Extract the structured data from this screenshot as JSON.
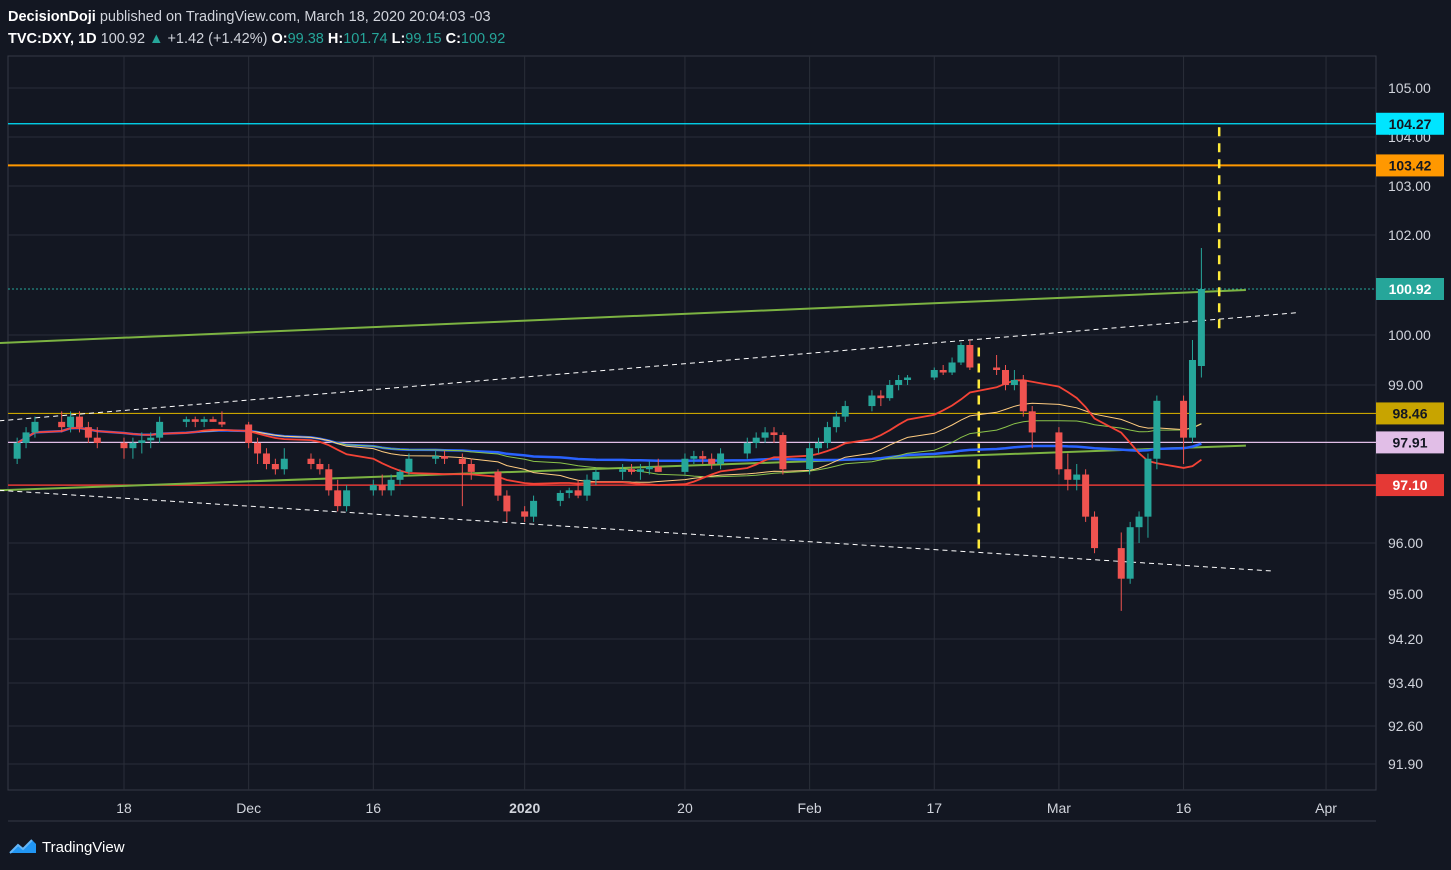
{
  "header": {
    "author": "DecisionDoji",
    "published": "published on TradingView.com, March 18, 2020 20:04:03 -03",
    "symbol": "TVC:DXY, 1D",
    "last": "100.92",
    "change": "+1.42 (+1.42%)",
    "o_label": "O:",
    "o_value": "99.38",
    "h_label": "H:",
    "h_value": "101.74",
    "l_label": "L:",
    "l_value": "99.15",
    "c_label": "C:",
    "c_value": "100.92"
  },
  "footer": {
    "brand": "TradingView"
  },
  "colors": {
    "background": "#131722",
    "grid": "#2a2e39",
    "up": "#26a69a",
    "down": "#ef5350",
    "cyan": "#00e5ff",
    "orange": "#ff9800",
    "gold": "#c8a400",
    "pink": "#e1bee7",
    "red": "#e53935",
    "green": "#7cb342",
    "yellow": "#ffeb3b",
    "blue": "#2962ff"
  },
  "chart_data": {
    "type": "candlestick",
    "x_ticks": [
      {
        "label": "18",
        "date": "2019-11-18",
        "bold": false
      },
      {
        "label": "Dec",
        "date": "2019-12-02",
        "bold": false
      },
      {
        "label": "16",
        "date": "2019-12-16",
        "bold": false
      },
      {
        "label": "2020",
        "date": "2020-01-02",
        "bold": true
      },
      {
        "label": "20",
        "date": "2020-01-20",
        "bold": false
      },
      {
        "label": "Feb",
        "date": "2020-02-03",
        "bold": false
      },
      {
        "label": "17",
        "date": "2020-02-17",
        "bold": false
      },
      {
        "label": "Mar",
        "date": "2020-03-02",
        "bold": false
      },
      {
        "label": "16",
        "date": "2020-03-16",
        "bold": false
      },
      {
        "label": "Apr",
        "date": "2020-04-01",
        "bold": false
      }
    ],
    "y_ticks": [
      "105.00",
      "104.00",
      "103.00",
      "102.00",
      "100.00",
      "99.00",
      "96.00",
      "95.00",
      "94.20",
      "93.40",
      "92.60",
      "91.90"
    ],
    "price_labels": [
      {
        "text": "104.27",
        "value": 104.27,
        "style": "cyan"
      },
      {
        "text": "103.42",
        "value": 103.42,
        "style": "orange"
      },
      {
        "text": "100.92",
        "value": 100.92,
        "style": "last"
      },
      {
        "text": "98.46",
        "value": 98.46,
        "style": "gold"
      },
      {
        "text": "97.91",
        "value": 97.91,
        "style": "pink"
      },
      {
        "text": "97.10",
        "value": 97.1,
        "style": "red"
      }
    ],
    "candles": [
      {
        "d": "2019-11-06",
        "o": 97.6,
        "h": 98.0,
        "l": 97.5,
        "c": 97.9
      },
      {
        "d": "2019-11-07",
        "o": 97.9,
        "h": 98.2,
        "l": 97.8,
        "c": 98.1
      },
      {
        "d": "2019-11-08",
        "o": 98.1,
        "h": 98.4,
        "l": 98.0,
        "c": 98.3
      },
      {
        "d": "2019-11-11",
        "o": 98.3,
        "h": 98.5,
        "l": 98.1,
        "c": 98.2
      },
      {
        "d": "2019-11-12",
        "o": 98.2,
        "h": 98.5,
        "l": 98.1,
        "c": 98.4
      },
      {
        "d": "2019-11-13",
        "o": 98.4,
        "h": 98.5,
        "l": 98.1,
        "c": 98.2
      },
      {
        "d": "2019-11-14",
        "o": 98.2,
        "h": 98.3,
        "l": 97.9,
        "c": 98.0
      },
      {
        "d": "2019-11-15",
        "o": 98.0,
        "h": 98.2,
        "l": 97.8,
        "c": 97.9
      },
      {
        "d": "2019-11-18",
        "o": 97.9,
        "h": 98.0,
        "l": 97.6,
        "c": 97.8
      },
      {
        "d": "2019-11-19",
        "o": 97.8,
        "h": 98.0,
        "l": 97.6,
        "c": 97.9
      },
      {
        "d": "2019-11-20",
        "o": 97.9,
        "h": 98.1,
        "l": 97.7,
        "c": 97.95
      },
      {
        "d": "2019-11-21",
        "o": 97.95,
        "h": 98.1,
        "l": 97.8,
        "c": 98.0
      },
      {
        "d": "2019-11-22",
        "o": 98.0,
        "h": 98.4,
        "l": 97.9,
        "c": 98.3
      },
      {
        "d": "2019-11-25",
        "o": 98.3,
        "h": 98.4,
        "l": 98.2,
        "c": 98.35
      },
      {
        "d": "2019-11-26",
        "o": 98.35,
        "h": 98.4,
        "l": 98.2,
        "c": 98.3
      },
      {
        "d": "2019-11-27",
        "o": 98.3,
        "h": 98.4,
        "l": 98.2,
        "c": 98.35
      },
      {
        "d": "2019-11-28",
        "o": 98.35,
        "h": 98.4,
        "l": 98.3,
        "c": 98.3
      },
      {
        "d": "2019-11-29",
        "o": 98.3,
        "h": 98.5,
        "l": 98.2,
        "c": 98.25
      },
      {
        "d": "2019-12-02",
        "o": 98.25,
        "h": 98.3,
        "l": 97.8,
        "c": 97.9
      },
      {
        "d": "2019-12-03",
        "o": 97.9,
        "h": 98.0,
        "l": 97.5,
        "c": 97.7
      },
      {
        "d": "2019-12-04",
        "o": 97.7,
        "h": 97.8,
        "l": 97.4,
        "c": 97.5
      },
      {
        "d": "2019-12-05",
        "o": 97.5,
        "h": 97.6,
        "l": 97.3,
        "c": 97.4
      },
      {
        "d": "2019-12-06",
        "o": 97.4,
        "h": 97.8,
        "l": 97.3,
        "c": 97.6
      },
      {
        "d": "2019-12-09",
        "o": 97.6,
        "h": 97.7,
        "l": 97.4,
        "c": 97.5
      },
      {
        "d": "2019-12-10",
        "o": 97.5,
        "h": 97.6,
        "l": 97.3,
        "c": 97.4
      },
      {
        "d": "2019-12-11",
        "o": 97.4,
        "h": 97.5,
        "l": 96.9,
        "c": 97.0
      },
      {
        "d": "2019-12-12",
        "o": 97.0,
        "h": 97.2,
        "l": 96.6,
        "c": 96.7
      },
      {
        "d": "2019-12-13",
        "o": 96.7,
        "h": 97.1,
        "l": 96.6,
        "c": 97.0
      },
      {
        "d": "2019-12-16",
        "o": 97.0,
        "h": 97.2,
        "l": 96.9,
        "c": 97.1
      },
      {
        "d": "2019-12-17",
        "o": 97.1,
        "h": 97.3,
        "l": 96.9,
        "c": 97.0
      },
      {
        "d": "2019-12-18",
        "o": 97.0,
        "h": 97.3,
        "l": 96.9,
        "c": 97.2
      },
      {
        "d": "2019-12-19",
        "o": 97.2,
        "h": 97.4,
        "l": 97.1,
        "c": 97.35
      },
      {
        "d": "2019-12-20",
        "o": 97.35,
        "h": 97.7,
        "l": 97.3,
        "c": 97.6
      },
      {
        "d": "2019-12-23",
        "o": 97.6,
        "h": 97.75,
        "l": 97.5,
        "c": 97.65
      },
      {
        "d": "2019-12-24",
        "o": 97.65,
        "h": 97.75,
        "l": 97.5,
        "c": 97.6
      },
      {
        "d": "2019-12-26",
        "o": 97.6,
        "h": 97.7,
        "l": 96.7,
        "c": 97.5
      },
      {
        "d": "2019-12-27",
        "o": 97.5,
        "h": 97.6,
        "l": 97.2,
        "c": 97.35
      },
      {
        "d": "2019-12-30",
        "o": 97.35,
        "h": 97.4,
        "l": 96.8,
        "c": 96.9
      },
      {
        "d": "2019-12-31",
        "o": 96.9,
        "h": 97.0,
        "l": 96.4,
        "c": 96.6
      },
      {
        "d": "2020-01-02",
        "o": 96.6,
        "h": 96.7,
        "l": 96.4,
        "c": 96.5
      },
      {
        "d": "2020-01-03",
        "o": 96.5,
        "h": 96.9,
        "l": 96.4,
        "c": 96.8
      },
      {
        "d": "2020-01-06",
        "o": 96.8,
        "h": 97.0,
        "l": 96.7,
        "c": 96.95
      },
      {
        "d": "2020-01-07",
        "o": 96.95,
        "h": 97.05,
        "l": 96.85,
        "c": 97.0
      },
      {
        "d": "2020-01-08",
        "o": 97.0,
        "h": 97.2,
        "l": 96.85,
        "c": 96.9
      },
      {
        "d": "2020-01-09",
        "o": 96.9,
        "h": 97.3,
        "l": 96.8,
        "c": 97.2
      },
      {
        "d": "2020-01-10",
        "o": 97.2,
        "h": 97.4,
        "l": 97.1,
        "c": 97.35
      },
      {
        "d": "2020-01-13",
        "o": 97.35,
        "h": 97.5,
        "l": 97.2,
        "c": 97.4
      },
      {
        "d": "2020-01-14",
        "o": 97.4,
        "h": 97.5,
        "l": 97.3,
        "c": 97.35
      },
      {
        "d": "2020-01-15",
        "o": 97.35,
        "h": 97.5,
        "l": 97.2,
        "c": 97.4
      },
      {
        "d": "2020-01-16",
        "o": 97.4,
        "h": 97.55,
        "l": 97.3,
        "c": 97.45
      },
      {
        "d": "2020-01-17",
        "o": 97.45,
        "h": 97.6,
        "l": 97.35,
        "c": 97.35
      },
      {
        "d": "2020-01-20",
        "o": 97.35,
        "h": 97.7,
        "l": 97.3,
        "c": 97.6
      },
      {
        "d": "2020-01-21",
        "o": 97.6,
        "h": 97.75,
        "l": 97.5,
        "c": 97.65
      },
      {
        "d": "2020-01-22",
        "o": 97.65,
        "h": 97.75,
        "l": 97.5,
        "c": 97.6
      },
      {
        "d": "2020-01-23",
        "o": 97.6,
        "h": 97.7,
        "l": 97.4,
        "c": 97.5
      },
      {
        "d": "2020-01-24",
        "o": 97.5,
        "h": 97.8,
        "l": 97.4,
        "c": 97.7
      },
      {
        "d": "2020-01-27",
        "o": 97.7,
        "h": 98.0,
        "l": 97.6,
        "c": 97.9
      },
      {
        "d": "2020-01-28",
        "o": 97.9,
        "h": 98.1,
        "l": 97.8,
        "c": 98.0
      },
      {
        "d": "2020-01-29",
        "o": 98.0,
        "h": 98.2,
        "l": 97.9,
        "c": 98.1
      },
      {
        "d": "2020-01-30",
        "o": 98.1,
        "h": 98.2,
        "l": 97.9,
        "c": 98.05
      },
      {
        "d": "2020-01-31",
        "o": 98.05,
        "h": 98.1,
        "l": 97.3,
        "c": 97.4
      },
      {
        "d": "2020-02-03",
        "o": 97.4,
        "h": 97.9,
        "l": 97.3,
        "c": 97.8
      },
      {
        "d": "2020-02-04",
        "o": 97.8,
        "h": 98.0,
        "l": 97.7,
        "c": 97.9
      },
      {
        "d": "2020-02-05",
        "o": 97.9,
        "h": 98.3,
        "l": 97.8,
        "c": 98.2
      },
      {
        "d": "2020-02-06",
        "o": 98.2,
        "h": 98.5,
        "l": 98.1,
        "c": 98.4
      },
      {
        "d": "2020-02-07",
        "o": 98.4,
        "h": 98.7,
        "l": 98.3,
        "c": 98.6
      },
      {
        "d": "2020-02-10",
        "o": 98.6,
        "h": 98.9,
        "l": 98.5,
        "c": 98.8
      },
      {
        "d": "2020-02-11",
        "o": 98.8,
        "h": 98.9,
        "l": 98.6,
        "c": 98.75
      },
      {
        "d": "2020-02-12",
        "o": 98.75,
        "h": 99.1,
        "l": 98.7,
        "c": 99.0
      },
      {
        "d": "2020-02-13",
        "o": 99.0,
        "h": 99.2,
        "l": 98.9,
        "c": 99.1
      },
      {
        "d": "2020-02-14",
        "o": 99.1,
        "h": 99.2,
        "l": 99.0,
        "c": 99.15
      },
      {
        "d": "2020-02-17",
        "o": 99.15,
        "h": 99.35,
        "l": 99.1,
        "c": 99.3
      },
      {
        "d": "2020-02-18",
        "o": 99.3,
        "h": 99.4,
        "l": 99.2,
        "c": 99.25
      },
      {
        "d": "2020-02-19",
        "o": 99.25,
        "h": 99.55,
        "l": 99.2,
        "c": 99.45
      },
      {
        "d": "2020-02-20",
        "o": 99.45,
        "h": 99.85,
        "l": 99.4,
        "c": 99.8
      },
      {
        "d": "2020-02-21",
        "o": 99.8,
        "h": 99.9,
        "l": 99.3,
        "c": 99.35
      },
      {
        "d": "2020-02-24",
        "o": 99.35,
        "h": 99.6,
        "l": 99.2,
        "c": 99.3
      },
      {
        "d": "2020-02-25",
        "o": 99.3,
        "h": 99.4,
        "l": 98.9,
        "c": 99.0
      },
      {
        "d": "2020-02-26",
        "o": 99.0,
        "h": 99.3,
        "l": 98.9,
        "c": 99.1
      },
      {
        "d": "2020-02-27",
        "o": 99.1,
        "h": 99.2,
        "l": 98.4,
        "c": 98.5
      },
      {
        "d": "2020-02-28",
        "o": 98.5,
        "h": 98.6,
        "l": 97.8,
        "c": 98.1
      },
      {
        "d": "2020-03-02",
        "o": 98.1,
        "h": 98.2,
        "l": 97.3,
        "c": 97.4
      },
      {
        "d": "2020-03-03",
        "o": 97.4,
        "h": 97.7,
        "l": 97.0,
        "c": 97.2
      },
      {
        "d": "2020-03-04",
        "o": 97.2,
        "h": 97.5,
        "l": 97.0,
        "c": 97.3
      },
      {
        "d": "2020-03-05",
        "o": 97.3,
        "h": 97.4,
        "l": 96.4,
        "c": 96.5
      },
      {
        "d": "2020-03-06",
        "o": 96.5,
        "h": 96.6,
        "l": 95.8,
        "c": 95.9
      },
      {
        "d": "2020-03-09",
        "o": 95.9,
        "h": 96.2,
        "l": 94.7,
        "c": 95.3
      },
      {
        "d": "2020-03-10",
        "o": 95.3,
        "h": 96.4,
        "l": 95.2,
        "c": 96.3
      },
      {
        "d": "2020-03-11",
        "o": 96.3,
        "h": 96.6,
        "l": 96.0,
        "c": 96.5
      },
      {
        "d": "2020-03-12",
        "o": 96.5,
        "h": 97.7,
        "l": 96.1,
        "c": 97.6
      },
      {
        "d": "2020-03-13",
        "o": 97.6,
        "h": 98.8,
        "l": 97.4,
        "c": 98.7
      },
      {
        "d": "2020-03-16",
        "o": 98.7,
        "h": 98.8,
        "l": 97.5,
        "c": 98.0
      },
      {
        "d": "2020-03-17",
        "o": 98.0,
        "h": 99.9,
        "l": 97.9,
        "c": 99.5
      },
      {
        "d": "2020-03-18",
        "o": 99.38,
        "h": 101.74,
        "l": 99.15,
        "c": 100.92
      }
    ]
  }
}
